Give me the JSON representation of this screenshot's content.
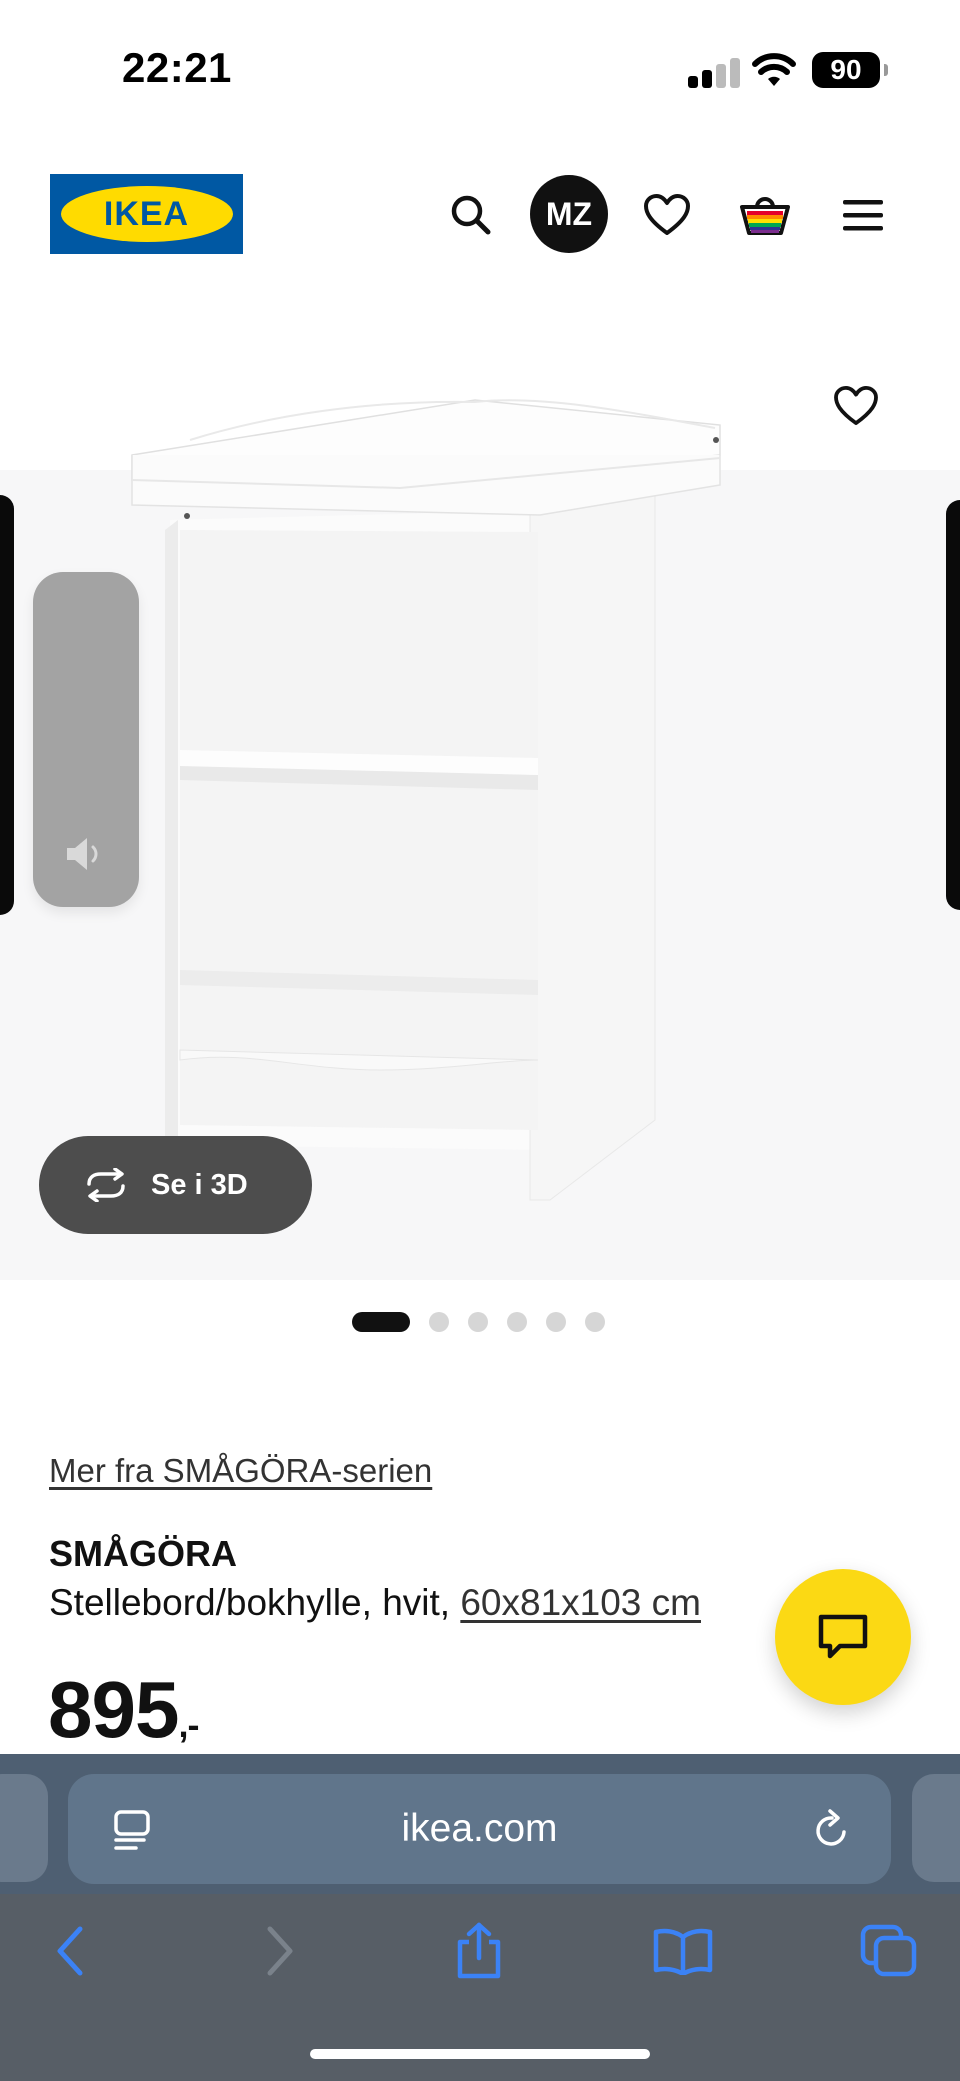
{
  "status_bar": {
    "time": "22:21",
    "battery": "90"
  },
  "header": {
    "logo_text": "IKEA",
    "avatar_initials": "MZ",
    "icons": [
      "search-icon",
      "heart-icon",
      "basket-icon",
      "menu-icon"
    ]
  },
  "gallery": {
    "view_3d_label": "Se i 3D",
    "dots_count": 6,
    "active_dot": 0
  },
  "product": {
    "series_link": "Mer fra SMÅGÖRA-serien",
    "name": "SMÅGÖRA",
    "description": "Stellebord/bokhylle, hvit,",
    "dimensions": "60x81x103 cm",
    "price": "895",
    "price_suffix": ",-"
  },
  "browser": {
    "url": "ikea.com"
  },
  "colors": {
    "ikea_blue": "#0058a3",
    "ikea_yellow": "#ffdb00",
    "chat_yellow": "#fbd914",
    "browser_bar": "#4e5f72",
    "toolbar_blue": "#3b82f6"
  }
}
